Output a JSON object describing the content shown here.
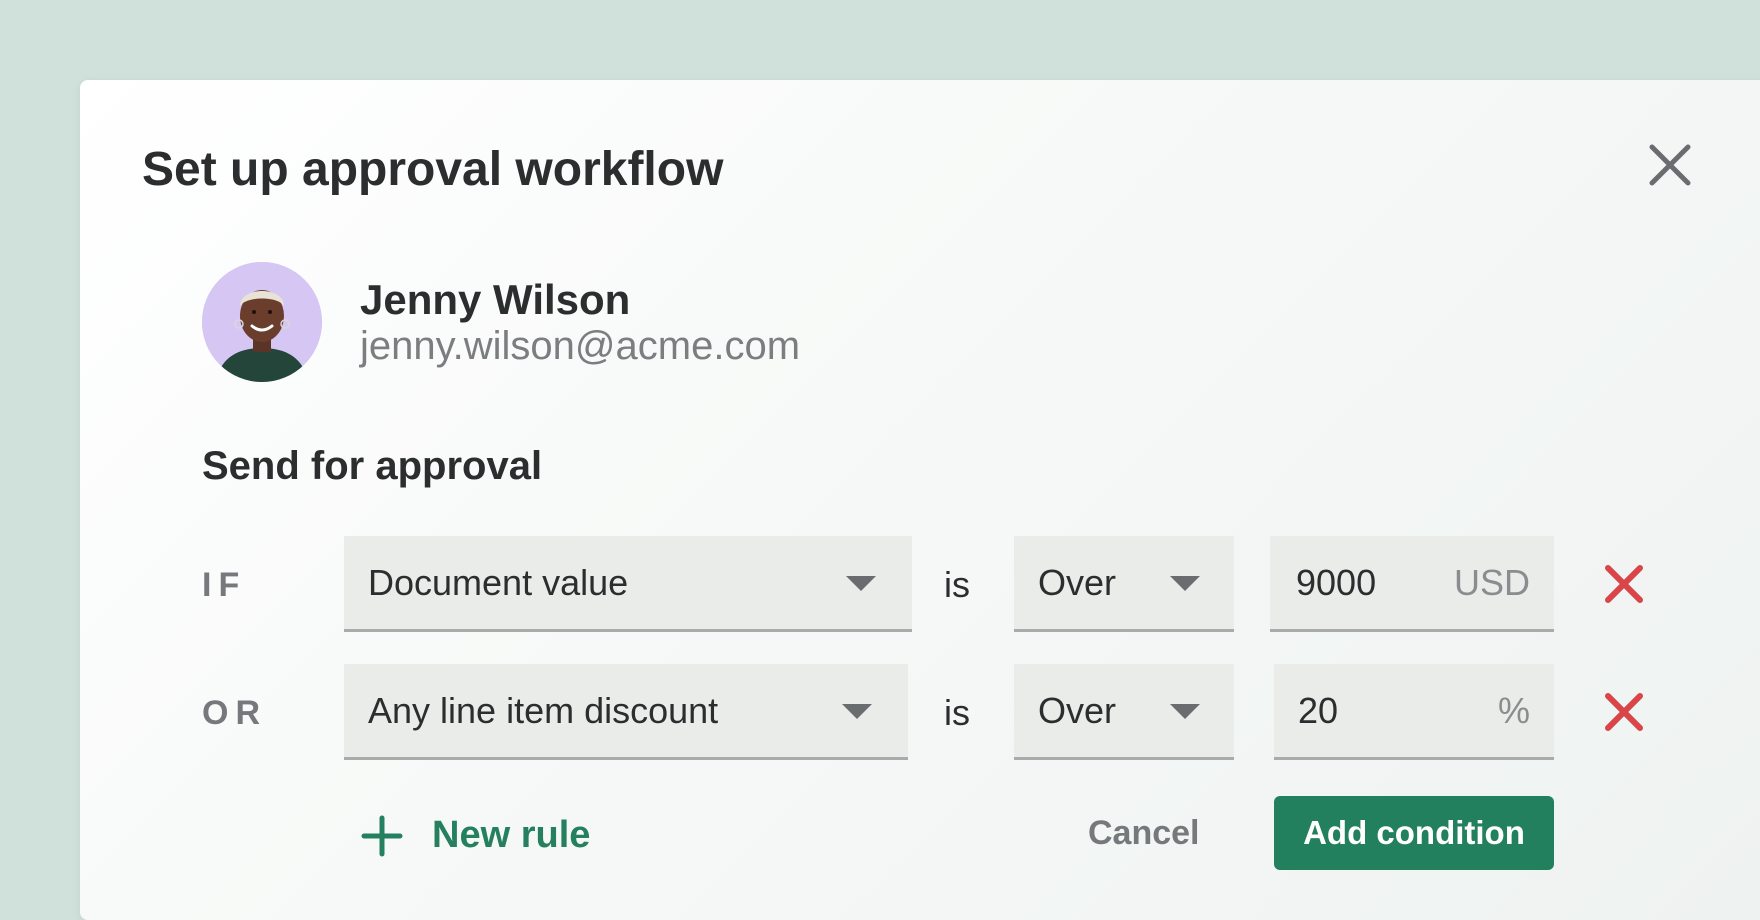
{
  "dialog": {
    "title": "Set up approval workflow",
    "close_icon": "close-icon"
  },
  "user": {
    "name": "Jenny Wilson",
    "email": "jenny.wilson@acme.com",
    "avatar_icon": "avatar-photo"
  },
  "section": {
    "title": "Send for approval"
  },
  "rules": [
    {
      "connector": "IF",
      "field": "Document value",
      "operator_label": "is",
      "comparator": "Over",
      "value": "9000",
      "unit": "USD"
    },
    {
      "connector": "OR",
      "field": "Any line item discount",
      "operator_label": "is",
      "comparator": "Over",
      "value": "20",
      "unit": "%"
    }
  ],
  "actions": {
    "new_rule": "New rule",
    "cancel": "Cancel",
    "add_condition": "Add condition"
  },
  "colors": {
    "background": "#cfe1da",
    "accent": "#23805f",
    "remove": "#d9464a"
  }
}
